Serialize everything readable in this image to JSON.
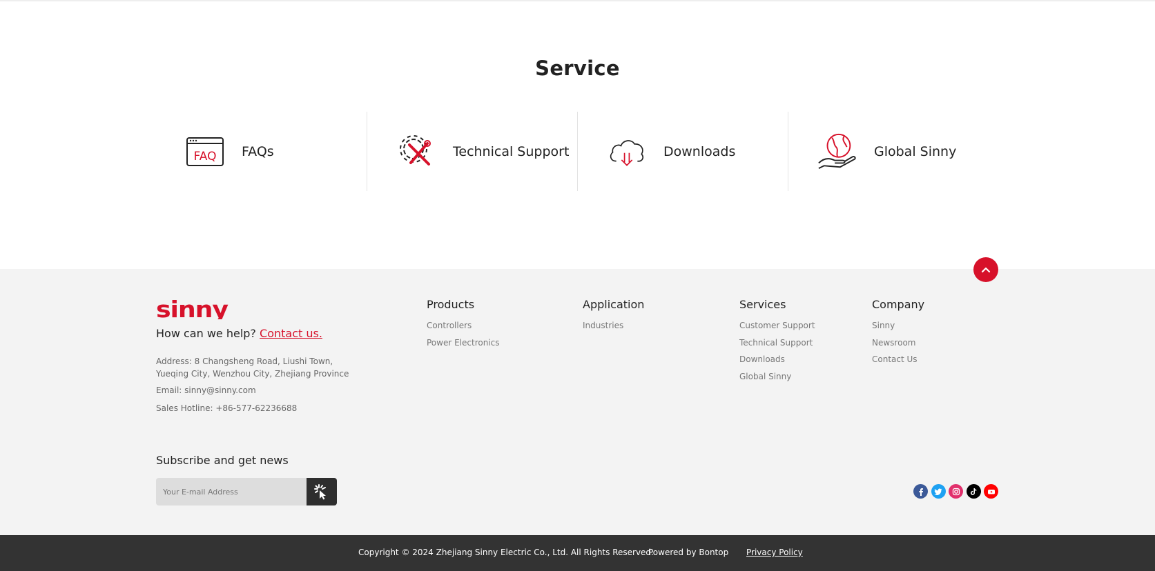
{
  "service": {
    "title": "Service",
    "items": [
      {
        "label": "FAQs",
        "icon": "faq-window-icon"
      },
      {
        "label": "Technical Support",
        "icon": "gear-tools-icon"
      },
      {
        "label": "Downloads",
        "icon": "cloud-download-icon"
      },
      {
        "label": "Global Sinny",
        "icon": "globe-hand-icon"
      }
    ]
  },
  "footer": {
    "logo_text": "sinny",
    "help_text": "How can we help?",
    "contact_link": "Contact us.",
    "address": "Address: 8 Changsheng Road, Liushi Town, Yueqing City, Wenzhou City, Zhejiang Province",
    "email": "Email: sinny@sinny.com",
    "hotline": "Sales Hotline: +86-577-62236688",
    "columns": [
      {
        "title": "Products",
        "items": [
          "Controllers",
          "Power Electronics"
        ]
      },
      {
        "title": "Application",
        "items": [
          "Industries"
        ]
      },
      {
        "title": "Services",
        "items": [
          "Customer Support",
          "Technical Support",
          "Downloads",
          "Global Sinny"
        ]
      },
      {
        "title": "Company",
        "items": [
          "Sinny",
          "Newsroom",
          "Contact Us"
        ]
      }
    ],
    "subscribe": {
      "title": "Subscribe and get news",
      "placeholder": "Your E-mail Address"
    },
    "socials": [
      {
        "name": "facebook-icon",
        "color": "#3b5998"
      },
      {
        "name": "twitter-icon",
        "color": "#1da1f2"
      },
      {
        "name": "instagram-icon",
        "color": "#e1306c"
      },
      {
        "name": "tiktok-icon",
        "color": "#000000"
      },
      {
        "name": "youtube-icon",
        "color": "#ff0000"
      }
    ]
  },
  "bottom": {
    "copyright": "Copyright © 2024 Zhejiang Sinny Electric Co., Ltd. All Rights Reserved.",
    "powered": "Powered by Bontop",
    "privacy": "Privacy Policy"
  },
  "colors": {
    "brand_red": "#d7112a",
    "footer_bg": "#f3f3f3",
    "bottom_bar": "#333333"
  }
}
